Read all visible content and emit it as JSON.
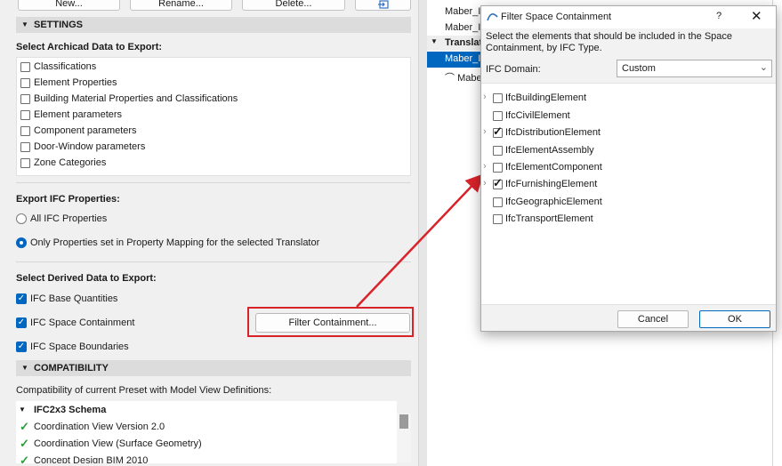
{
  "toolbar": {
    "new_label": "New...",
    "rename_label": "Rename...",
    "delete_label": "Delete..."
  },
  "settings": {
    "header": "SETTINGS",
    "select_title": "Select Archicad Data to Export:",
    "items": [
      "Classifications",
      "Element Properties",
      "Building Material Properties and Classifications",
      "Element parameters",
      "Component parameters",
      "Door-Window parameters",
      "Zone Categories"
    ]
  },
  "export_props": {
    "title": "Export IFC Properties:",
    "options": [
      {
        "label": "All IFC Properties",
        "selected": false
      },
      {
        "label": "Only Properties set in Property Mapping for the selected Translator",
        "selected": true
      }
    ]
  },
  "derived": {
    "title": "Select Derived Data to Export:",
    "items": [
      {
        "label": "IFC Base Quantities",
        "checked": true
      },
      {
        "label": "IFC Space Containment",
        "checked": true
      },
      {
        "label": "IFC Space Boundaries",
        "checked": true
      }
    ],
    "filter_button": "Filter Containment..."
  },
  "compatibility": {
    "header": "COMPATIBILITY",
    "description": "Compatibility of current Preset with Model View Definitions:",
    "schema": "IFC2x3 Schema",
    "items": [
      "Coordination View Version 2.0",
      "Coordination View (Surface Geometry)",
      "Concept Design BIM 2010"
    ]
  },
  "right_panel": {
    "items": [
      "Maber_IF",
      "Maber_IF",
      "Translato",
      "Maber_IF",
      "Mabe"
    ]
  },
  "dialog": {
    "title": "Filter Space Containment",
    "help": "?",
    "close": "✕",
    "description": "Select the elements that should be included in the Space Containment, by IFC Type.",
    "domain_label": "IFC Domain:",
    "domain_value": "Custom",
    "items": [
      {
        "label": "IfcBuildingElement",
        "checked": false,
        "expandable": true
      },
      {
        "label": "IfcCivilElement",
        "checked": false,
        "expandable": false
      },
      {
        "label": "IfcDistributionElement",
        "checked": true,
        "expandable": true
      },
      {
        "label": "IfcElementAssembly",
        "checked": false,
        "expandable": false
      },
      {
        "label": "IfcElementComponent",
        "checked": false,
        "expandable": true
      },
      {
        "label": "IfcFurnishingElement",
        "checked": true,
        "expandable": true
      },
      {
        "label": "IfcGeographicElement",
        "checked": false,
        "expandable": false
      },
      {
        "label": "IfcTransportElement",
        "checked": false,
        "expandable": false
      }
    ],
    "cancel_label": "Cancel",
    "ok_label": "OK"
  },
  "colors": {
    "accent": "#0067c0",
    "highlight": "#d9232a",
    "check_green": "#2a9d3a"
  }
}
